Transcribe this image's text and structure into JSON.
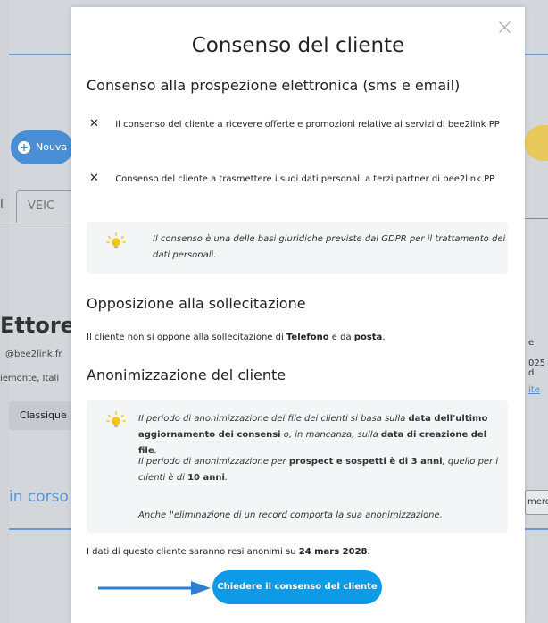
{
  "background": {
    "new_button_label": "Nouva",
    "tab_label": "VEIC",
    "tab_left_fragment": "I",
    "contact_name": "Ettore I",
    "contact_email": "@bee2link.fr",
    "contact_location": "iemonte, Itali",
    "category_label": "Classique",
    "section_label": "in corso",
    "right_text_1": "e",
    "right_text_2": "025 d",
    "right_link": "ite",
    "right_field": "mero"
  },
  "modal": {
    "title": "Consenso del cliente",
    "section_prospection": {
      "heading": "Consenso alla prospezione elettronica (sms e email)",
      "items": [
        {
          "icon": "x-icon",
          "mark": "✕",
          "label": "Il consenso del cliente a ricevere offerte e promozioni relative ai servizi di bee2link PP"
        },
        {
          "icon": "x-icon",
          "mark": "✕",
          "label": "Consenso del cliente a trasmettere i suoi dati personali a terzi partner di bee2link PP"
        }
      ],
      "info_line1": "Il consenso è una delle basi giuridiche previste dal GDPR per il trattamento dei",
      "info_line2": "dati personali."
    },
    "section_opposition": {
      "heading": "Opposizione alla sollecitazione",
      "text_pre": "Il cliente non si oppone alla sollecitazione di ",
      "bold1": "Telefono",
      "text_mid": " e da ",
      "bold2": "posta",
      "text_end": "."
    },
    "section_anonym": {
      "heading": "Anonimizzazione del cliente",
      "p1_a": "Il periodo di anonimizzazione dei file dei clienti si basa sulla ",
      "p1_b": "data dell'ultimo",
      "p1_c": "aggiornamento dei consensi",
      "p1_d": " o, in mancanza, sulla ",
      "p1_e": "data di creazione del file",
      "p1_f": ".",
      "p2_a": "Il periodo di anonimizzazione per ",
      "p2_b": "prospect e sospetti è di 3 anni",
      "p2_c": ", quello per i",
      "p2_d": "clienti è di ",
      "p2_e": "10 anni",
      "p2_f": ".",
      "p3": "Anche l'eliminazione di un record comporta la sua anonimizzazione."
    },
    "anonym_date_pre": "I dati di questo cliente saranno resi anonimi su ",
    "anonym_date": "24 mars 2028",
    "anonym_date_end": ".",
    "cta_label": "Chiedere il consenso del cliente"
  },
  "colors": {
    "cta": "#0d9be8",
    "arrow": "#2f7fd0",
    "bulb": "#f5c518"
  }
}
